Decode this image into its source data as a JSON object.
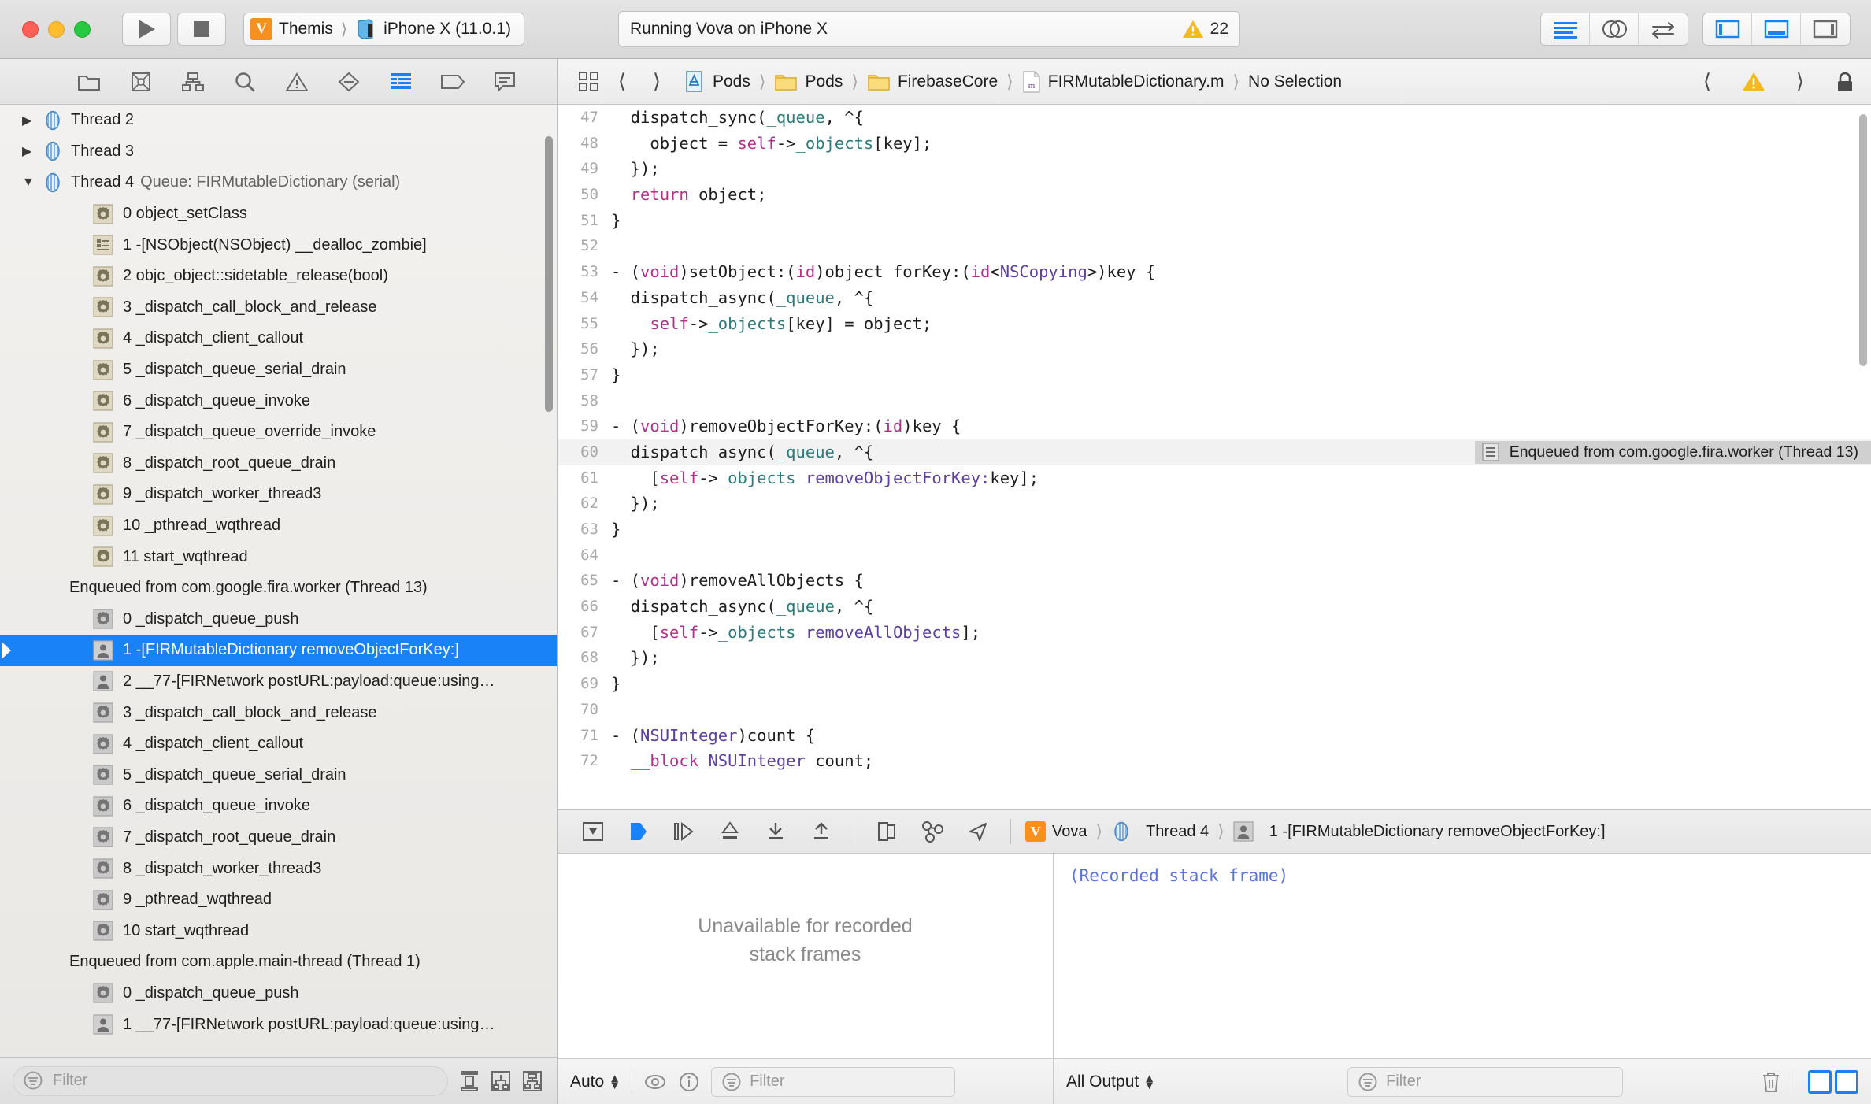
{
  "titlebar": {
    "run_label": "Run",
    "stop_label": "Stop",
    "scheme": "Themis",
    "destination": "iPhone X (11.0.1)",
    "status": "Running Vova on iPhone X",
    "warning_count": "22",
    "buttons": {
      "standard_editor": "standard-editor",
      "assistant_editor": "assistant-editor",
      "version_editor": "version-editor",
      "navigator_toggle": "navigator",
      "debug_toggle": "debug-area",
      "utilities_toggle": "utilities"
    }
  },
  "navigator": {
    "toolbar_icons": [
      "project-navigator",
      "source-control-navigator",
      "symbol-navigator",
      "find-navigator",
      "issue-navigator",
      "test-navigator",
      "debug-navigator",
      "breakpoint-navigator",
      "report-navigator"
    ],
    "selected_tab": "debug-navigator",
    "filter_placeholder": "Filter",
    "rows": [
      {
        "type": "thread",
        "disclosure": "collapsed",
        "label": "Thread 2",
        "sub": ""
      },
      {
        "type": "thread",
        "disclosure": "collapsed",
        "label": "Thread 3",
        "sub": ""
      },
      {
        "type": "thread",
        "disclosure": "expanded",
        "label": "Thread 4",
        "sub": "Queue: FIRMutableDictionary (serial)"
      },
      {
        "type": "frame",
        "icon": "system",
        "label": "0 object_setClass"
      },
      {
        "type": "frame",
        "icon": "library",
        "label": "1 -[NSObject(NSObject) __dealloc_zombie]"
      },
      {
        "type": "frame",
        "icon": "system",
        "label": "2 objc_object::sidetable_release(bool)"
      },
      {
        "type": "frame",
        "icon": "system",
        "label": "3 _dispatch_call_block_and_release"
      },
      {
        "type": "frame",
        "icon": "system",
        "label": "4 _dispatch_client_callout"
      },
      {
        "type": "frame",
        "icon": "system",
        "label": "5 _dispatch_queue_serial_drain"
      },
      {
        "type": "frame",
        "icon": "system",
        "label": "6 _dispatch_queue_invoke"
      },
      {
        "type": "frame",
        "icon": "system",
        "label": "7 _dispatch_queue_override_invoke"
      },
      {
        "type": "frame",
        "icon": "system",
        "label": "8 _dispatch_root_queue_drain"
      },
      {
        "type": "frame",
        "icon": "system",
        "label": "9 _dispatch_worker_thread3"
      },
      {
        "type": "frame",
        "icon": "system",
        "label": "10 _pthread_wqthread"
      },
      {
        "type": "frame",
        "icon": "system",
        "label": "11 start_wqthread"
      },
      {
        "type": "enqueued",
        "label": "Enqueued from com.google.fira.worker (Thread 13)"
      },
      {
        "type": "frame",
        "icon": "systemgray",
        "label": "0 _dispatch_queue_push"
      },
      {
        "type": "frame",
        "icon": "user",
        "selected": true,
        "label": "1 -[FIRMutableDictionary removeObjectForKey:]"
      },
      {
        "type": "frame",
        "icon": "user",
        "label": "2 __77-[FIRNetwork postURL:payload:queue:using…"
      },
      {
        "type": "frame",
        "icon": "systemgray",
        "label": "3 _dispatch_call_block_and_release"
      },
      {
        "type": "frame",
        "icon": "systemgray",
        "label": "4 _dispatch_client_callout"
      },
      {
        "type": "frame",
        "icon": "systemgray",
        "label": "5 _dispatch_queue_serial_drain"
      },
      {
        "type": "frame",
        "icon": "systemgray",
        "label": "6 _dispatch_queue_invoke"
      },
      {
        "type": "frame",
        "icon": "systemgray",
        "label": "7 _dispatch_root_queue_drain"
      },
      {
        "type": "frame",
        "icon": "systemgray",
        "label": "8 _dispatch_worker_thread3"
      },
      {
        "type": "frame",
        "icon": "systemgray",
        "label": "9 _pthread_wqthread"
      },
      {
        "type": "frame",
        "icon": "systemgray",
        "label": "10 start_wqthread"
      },
      {
        "type": "enqueued",
        "label": "Enqueued from com.apple.main-thread (Thread 1)"
      },
      {
        "type": "frame",
        "icon": "systemgray",
        "label": "0 _dispatch_queue_push"
      },
      {
        "type": "frame",
        "icon": "user",
        "label": "1 __77-[FIRNetwork postURL:payload:queue:using…"
      }
    ],
    "footer_buttons": [
      "show-only-crashed-threads",
      "view-process-by-thread",
      "view-process-by-queue"
    ]
  },
  "editor": {
    "breadcrumbs": [
      {
        "icon": "project",
        "label": "Pods"
      },
      {
        "icon": "folder",
        "label": "Pods"
      },
      {
        "icon": "folder",
        "label": "FirebaseCore"
      },
      {
        "icon": "objc-file",
        "label": "FIRMutableDictionary.m"
      },
      {
        "icon": "none",
        "label": "No Selection"
      }
    ],
    "back_label": "Back",
    "forward_label": "Forward",
    "related_items_label": "Related Items",
    "annotation": "Enqueued from com.google.fira.worker (Thread 13)",
    "highlighted_line": 60,
    "lines": [
      {
        "n": "47",
        "tokens": [
          {
            "t": "  dispatch_sync(",
            "c": "p"
          },
          {
            "t": "_queue",
            "c": "id2"
          },
          {
            "t": ", ^{",
            "c": "p"
          }
        ]
      },
      {
        "n": "48",
        "tokens": [
          {
            "t": "    object = ",
            "c": "p"
          },
          {
            "t": "self",
            "c": "kw"
          },
          {
            "t": "->",
            "c": "p"
          },
          {
            "t": "_objects",
            "c": "id2"
          },
          {
            "t": "[key];",
            "c": "p"
          }
        ]
      },
      {
        "n": "49",
        "tokens": [
          {
            "t": "  });",
            "c": "p"
          }
        ]
      },
      {
        "n": "50",
        "tokens": [
          {
            "t": "  ",
            "c": "p"
          },
          {
            "t": "return",
            "c": "kw"
          },
          {
            "t": " object;",
            "c": "p"
          }
        ]
      },
      {
        "n": "51",
        "tokens": [
          {
            "t": "}",
            "c": "p"
          }
        ]
      },
      {
        "n": "52",
        "tokens": [
          {
            "t": "",
            "c": "p"
          }
        ]
      },
      {
        "n": "53",
        "tokens": [
          {
            "t": "- (",
            "c": "p"
          },
          {
            "t": "void",
            "c": "kw"
          },
          {
            "t": ")setObject:(",
            "c": "p"
          },
          {
            "t": "id",
            "c": "kw"
          },
          {
            "t": ")object forKey:(",
            "c": "p"
          },
          {
            "t": "id",
            "c": "kw"
          },
          {
            "t": "<",
            "c": "p"
          },
          {
            "t": "NSCopying",
            "c": "ty"
          },
          {
            "t": ">)key {",
            "c": "p"
          }
        ]
      },
      {
        "n": "54",
        "tokens": [
          {
            "t": "  dispatch_async(",
            "c": "p"
          },
          {
            "t": "_queue",
            "c": "id2"
          },
          {
            "t": ", ^{",
            "c": "p"
          }
        ]
      },
      {
        "n": "55",
        "tokens": [
          {
            "t": "    ",
            "c": "p"
          },
          {
            "t": "self",
            "c": "kw"
          },
          {
            "t": "->",
            "c": "p"
          },
          {
            "t": "_objects",
            "c": "id2"
          },
          {
            "t": "[key] = object;",
            "c": "p"
          }
        ]
      },
      {
        "n": "56",
        "tokens": [
          {
            "t": "  });",
            "c": "p"
          }
        ]
      },
      {
        "n": "57",
        "tokens": [
          {
            "t": "}",
            "c": "p"
          }
        ]
      },
      {
        "n": "58",
        "tokens": [
          {
            "t": "",
            "c": "p"
          }
        ]
      },
      {
        "n": "59",
        "tokens": [
          {
            "t": "- (",
            "c": "p"
          },
          {
            "t": "void",
            "c": "kw"
          },
          {
            "t": ")removeObjectForKey:(",
            "c": "p"
          },
          {
            "t": "id",
            "c": "kw"
          },
          {
            "t": ")key {",
            "c": "p"
          }
        ]
      },
      {
        "n": "60",
        "tokens": [
          {
            "t": "  dispatch_async(",
            "c": "p"
          },
          {
            "t": "_queue",
            "c": "id2"
          },
          {
            "t": ", ^{",
            "c": "p"
          }
        ]
      },
      {
        "n": "61",
        "tokens": [
          {
            "t": "    [",
            "c": "p"
          },
          {
            "t": "self",
            "c": "kw"
          },
          {
            "t": "->",
            "c": "p"
          },
          {
            "t": "_objects",
            "c": "id2"
          },
          {
            "t": " ",
            "c": "p"
          },
          {
            "t": "removeObjectForKey:",
            "c": "msg"
          },
          {
            "t": "key];",
            "c": "p"
          }
        ]
      },
      {
        "n": "62",
        "tokens": [
          {
            "t": "  });",
            "c": "p"
          }
        ]
      },
      {
        "n": "63",
        "tokens": [
          {
            "t": "}",
            "c": "p"
          }
        ]
      },
      {
        "n": "64",
        "tokens": [
          {
            "t": "",
            "c": "p"
          }
        ]
      },
      {
        "n": "65",
        "tokens": [
          {
            "t": "- (",
            "c": "p"
          },
          {
            "t": "void",
            "c": "kw"
          },
          {
            "t": ")removeAllObjects {",
            "c": "p"
          }
        ]
      },
      {
        "n": "66",
        "tokens": [
          {
            "t": "  dispatch_async(",
            "c": "p"
          },
          {
            "t": "_queue",
            "c": "id2"
          },
          {
            "t": ", ^{",
            "c": "p"
          }
        ]
      },
      {
        "n": "67",
        "tokens": [
          {
            "t": "    [",
            "c": "p"
          },
          {
            "t": "self",
            "c": "kw"
          },
          {
            "t": "->",
            "c": "p"
          },
          {
            "t": "_objects",
            "c": "id2"
          },
          {
            "t": " ",
            "c": "p"
          },
          {
            "t": "removeAllObjects",
            "c": "msg"
          },
          {
            "t": "];",
            "c": "p"
          }
        ]
      },
      {
        "n": "68",
        "tokens": [
          {
            "t": "  });",
            "c": "p"
          }
        ]
      },
      {
        "n": "69",
        "tokens": [
          {
            "t": "}",
            "c": "p"
          }
        ]
      },
      {
        "n": "70",
        "tokens": [
          {
            "t": "",
            "c": "p"
          }
        ]
      },
      {
        "n": "71",
        "tokens": [
          {
            "t": "- (",
            "c": "p"
          },
          {
            "t": "NSUInteger",
            "c": "ty"
          },
          {
            "t": ")count {",
            "c": "p"
          }
        ]
      },
      {
        "n": "72",
        "tokens": [
          {
            "t": "  ",
            "c": "p"
          },
          {
            "t": "__block",
            "c": "kw"
          },
          {
            "t": " ",
            "c": "p"
          },
          {
            "t": "NSUInteger",
            "c": "ty"
          },
          {
            "t": " count;",
            "c": "p"
          }
        ]
      }
    ]
  },
  "debugbar": {
    "icons": [
      "hide-debug-area",
      "continue",
      "step-over",
      "step-into",
      "step-out",
      "debug-view-hierarchy",
      "debug-memory-graph",
      "simulate-location"
    ],
    "crumbs": [
      {
        "icon": "scheme",
        "label": "Vova"
      },
      {
        "icon": "thread",
        "label": "Thread 4"
      },
      {
        "icon": "user-frame",
        "label": "1 -[FIRMutableDictionary removeObjectForKey:]"
      }
    ]
  },
  "variables_pane": {
    "empty_message_line1": "Unavailable for recorded",
    "empty_message_line2": "stack frames",
    "scope_popup": "Auto",
    "filter_placeholder": "Filter",
    "icons": [
      "watch-expression",
      "info"
    ]
  },
  "console_pane": {
    "output": "(Recorded stack frame)",
    "output_popup": "All Output",
    "filter_placeholder": "Filter",
    "clear_label": "clear-console",
    "split_buttons": [
      "show-variables-view",
      "show-console-view"
    ]
  },
  "colors": {
    "accent": "#1a82f7",
    "scheme_orange": "#f7901e",
    "warning_yellow": "#f5b81e",
    "keyword": "#b2308a",
    "type": "#5c3fa0",
    "ivar": "#2c7a7a",
    "console_text": "#5872dd"
  }
}
